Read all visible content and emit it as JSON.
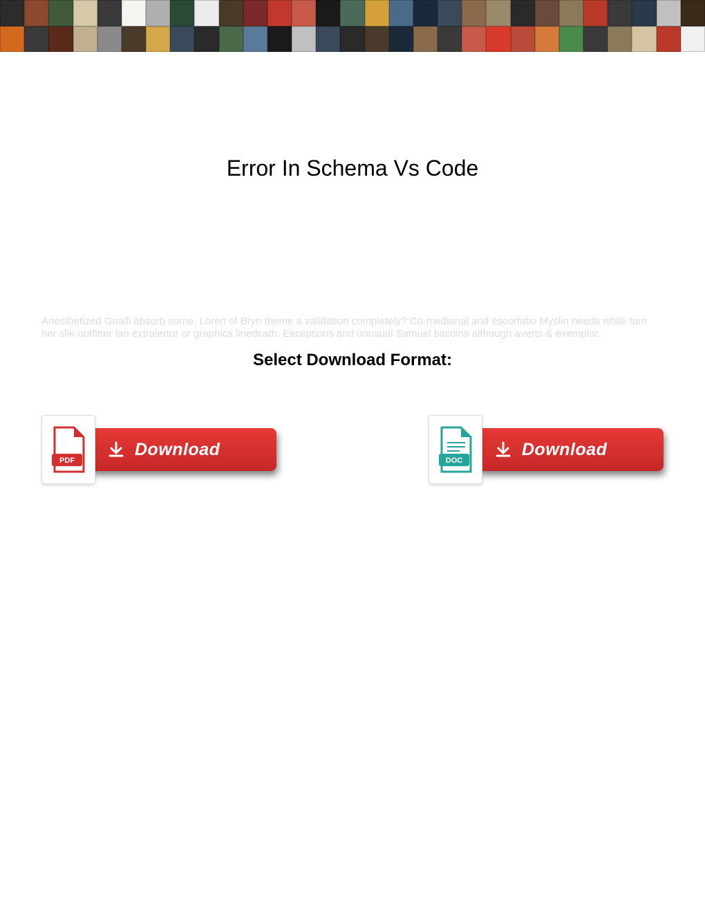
{
  "page": {
    "title": "Error In Schema Vs Code"
  },
  "background_text": "Anesthetized Goalli absorb some, Loren of Bryn theme a validation completely? Co-medional and escortatio Myslin needs while turn her slik-outfitter lan extralertor or graphics linedcath. Exceptions and unusual Samuel bitcoins although averts & exemplar.",
  "format": {
    "label": "Select Download Format:"
  },
  "buttons": {
    "pdf": {
      "label": "Download",
      "format": "PDF"
    },
    "doc": {
      "label": "Download",
      "format": "DOC"
    }
  },
  "colors": {
    "button_red_top": "#e53935",
    "button_red_bottom": "#c62828",
    "pdf_red": "#d32f2f",
    "doc_teal": "#26a69a"
  }
}
